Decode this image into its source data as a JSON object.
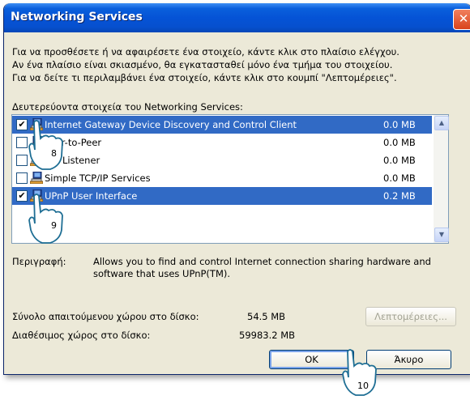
{
  "window": {
    "title": "Networking Services"
  },
  "intro": {
    "line1": "Για να προσθέσετε ή να αφαιρέσετε ένα στοιχείο, κάντε κλικ στο πλαίσιο ελέγχου.",
    "line2": "Αν ένα πλαίσιο είναι  σκιασμένο, θα εγκατασταθεί μόνο ένα τμήμα του στοιχείου.",
    "line3": "Για να δείτε τι περιλαμβάνει ένα στοιχείο, κάντε κλικ στο κουμπί \"Λεπτομέρειες\"."
  },
  "list": {
    "label": "Δευτερεύοντα στοιχεία του Networking Services:",
    "items": [
      {
        "name": "Internet Gateway Device Discovery and Control Client",
        "size": "0.0 MB",
        "checked": true,
        "selected": true
      },
      {
        "name": "Peer-to-Peer",
        "size": "0.0 MB",
        "checked": false,
        "selected": false
      },
      {
        "name": "RIP Listener",
        "size": "0.0 MB",
        "checked": false,
        "selected": false
      },
      {
        "name": "Simple TCP/IP Services",
        "size": "0.0 MB",
        "checked": false,
        "selected": false
      },
      {
        "name": "UPnP User Interface",
        "size": "0.2 MB",
        "checked": true,
        "selected": true
      }
    ]
  },
  "description": {
    "label": "Περιγραφή:",
    "line1": "Allows you to find and control Internet connection sharing hardware and",
    "line2": "software that uses UPnP(TM)."
  },
  "disk": {
    "required_label": "Σύνολο απαιτούμενου χώρου στο δίσκο:",
    "required_value": "54.5 MB",
    "available_label": "Διαθέσιμος χώρος στο δίσκο:",
    "available_value": "59983.2 MB"
  },
  "buttons": {
    "details": "Λεπτομέρειες...",
    "ok": "OK",
    "cancel": "Άκυρο"
  },
  "annotations": {
    "step8": "8",
    "step9": "9",
    "step10": "10"
  },
  "colors": {
    "titlebar": "#0553d6",
    "selection": "#316ac5",
    "dialog_bg": "#ece9d8"
  }
}
